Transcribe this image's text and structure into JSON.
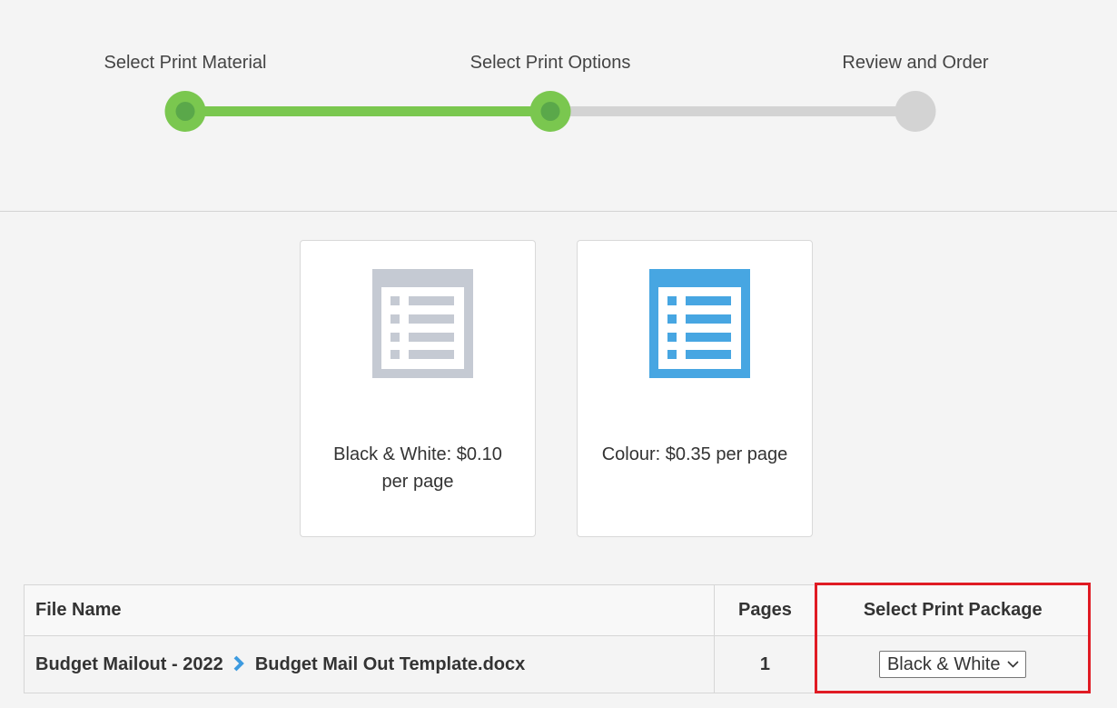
{
  "stepper": {
    "steps": [
      {
        "label": "Select Print Material",
        "state": "complete"
      },
      {
        "label": "Select Print Options",
        "state": "current"
      },
      {
        "label": "Review and Order",
        "state": "pending"
      }
    ],
    "colors": {
      "complete": "#7ac74f",
      "pending": "#d3d3d3"
    }
  },
  "options": [
    {
      "label": "Black & White: $0.10 per page",
      "icon": "document-list-icon",
      "color": "#c5cad3"
    },
    {
      "label": "Colour: $0.35 per page",
      "icon": "document-list-icon",
      "color": "#47a6e2"
    }
  ],
  "table": {
    "headers": {
      "file_name": "File Name",
      "pages": "Pages",
      "package": "Select Print Package"
    },
    "rows": [
      {
        "folder": "Budget Mailout - 2022",
        "file": "Budget Mail Out Template.docx",
        "pages": "1",
        "package": "Black & White"
      }
    ]
  },
  "highlight_color": "#e01b24"
}
